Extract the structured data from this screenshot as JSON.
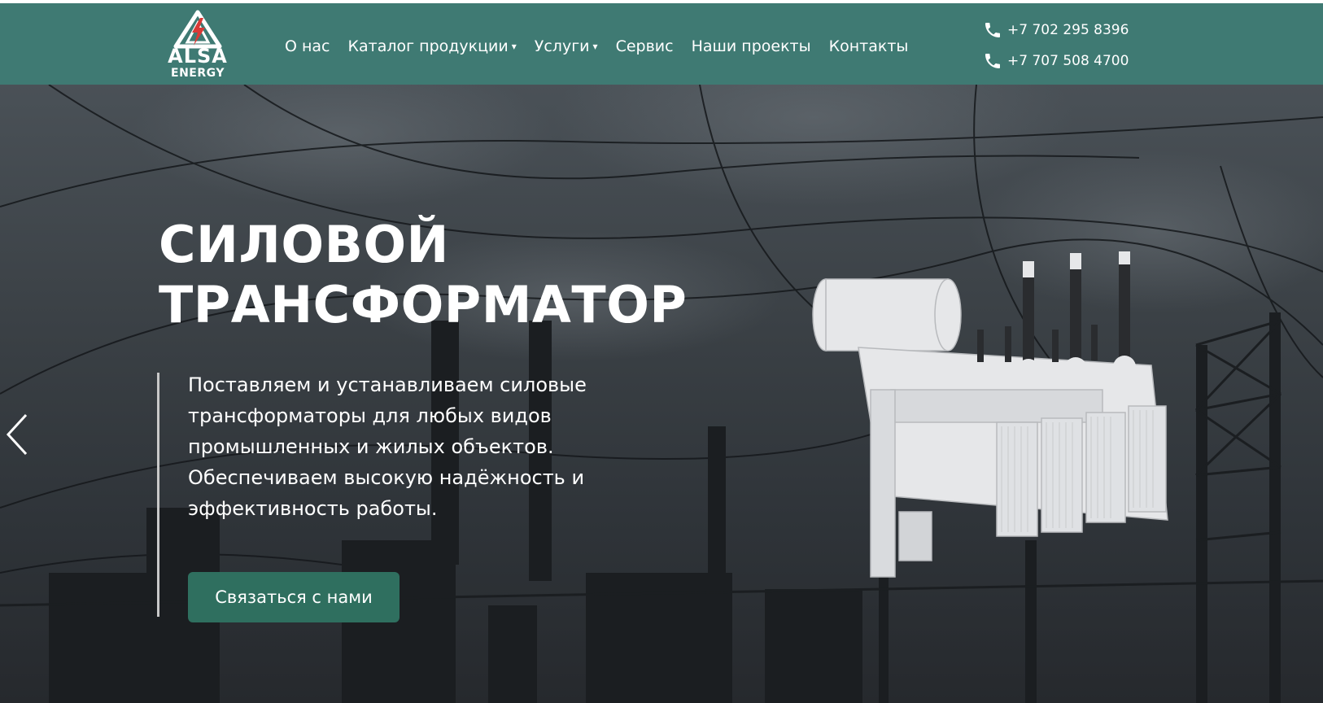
{
  "brand": {
    "name": "ALSA",
    "sub": "ENERGY",
    "accent_color": "#d93a36",
    "header_color": "#3f7a73"
  },
  "nav": {
    "items": [
      {
        "label": "О нас",
        "has_dropdown": false
      },
      {
        "label": "Каталог продукции",
        "has_dropdown": true
      },
      {
        "label": "Услуги",
        "has_dropdown": true
      },
      {
        "label": "Сервис",
        "has_dropdown": false
      },
      {
        "label": "Наши проекты",
        "has_dropdown": false
      },
      {
        "label": "Контакты",
        "has_dropdown": false
      }
    ],
    "caret": "▾"
  },
  "phones": [
    "+7 702 295 8396",
    "+7 707 508 4700"
  ],
  "hero": {
    "title_line1": "СИЛОВОЙ",
    "title_line2": "ТРАНСФОРМАТОР",
    "description": "Поставляем и устанавливаем силовые трансформаторы для любых видов промышленных и жилых объектов. Обеспечиваем высокую надёжность и эффективность работы.",
    "cta_label": "Связаться с нами",
    "cta_color": "#2f6f5f"
  },
  "icons": {
    "phone": "phone-icon",
    "prev": "chevron-left-icon"
  }
}
